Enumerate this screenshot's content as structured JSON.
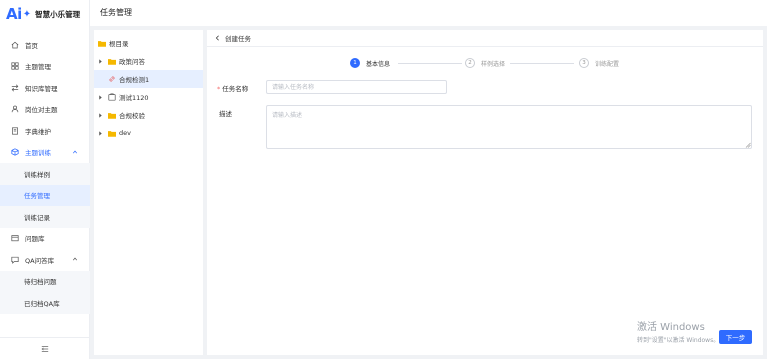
{
  "app": {
    "logo_mark": "Ai",
    "logo_star": "✦",
    "name": "智慧小乐管理"
  },
  "header": {
    "title": "任务管理"
  },
  "sidebar": {
    "items": [
      {
        "label": "首页",
        "icon": "home-icon"
      },
      {
        "label": "主题管理",
        "icon": "grid-icon"
      },
      {
        "label": "知识库管理",
        "icon": "swap-icon"
      },
      {
        "label": "岗位对主题",
        "icon": "user-icon"
      },
      {
        "label": "字典维护",
        "icon": "book-icon"
      },
      {
        "label": "主题训练",
        "icon": "cube-icon",
        "expanded": true,
        "children": [
          {
            "label": "训练样例"
          },
          {
            "label": "任务管理",
            "active": true
          },
          {
            "label": "训练记录"
          }
        ]
      },
      {
        "label": "问题库",
        "icon": "box-icon"
      },
      {
        "label": "QA问答库",
        "icon": "chat-icon",
        "expanded": true,
        "children": [
          {
            "label": "待归档问题"
          },
          {
            "label": "已归档QA库"
          }
        ]
      }
    ]
  },
  "tree": {
    "nodes": [
      {
        "label": "根目录",
        "icon": "folder-icon"
      },
      {
        "label": "政策问答",
        "icon": "folder-icon"
      },
      {
        "label": "合规检测1",
        "icon": "link-icon",
        "active": true
      },
      {
        "label": "测试1120",
        "icon": "box-icon"
      },
      {
        "label": "合规校验",
        "icon": "folder-icon"
      },
      {
        "label": "dev",
        "icon": "folder-icon"
      }
    ]
  },
  "main": {
    "back_label": "创建任务",
    "steps": [
      {
        "num": "1",
        "label": "基本信息",
        "active": true
      },
      {
        "num": "2",
        "label": "样例选择",
        "active": false
      },
      {
        "num": "3",
        "label": "训练配置",
        "active": false
      }
    ],
    "form": {
      "task_name_label": "任务名称",
      "task_name_placeholder": "请输入任务名称",
      "task_name_value": "",
      "desc_label": "描述",
      "desc_placeholder": "请输入描述",
      "desc_value": ""
    },
    "next_label": "下一步"
  },
  "watermark": {
    "line1": "激活 Windows",
    "line2": "转到\"设置\"以激活 Windows。"
  },
  "colors": {
    "accent": "#2f6bff",
    "required": "#f56c6c",
    "folder": "#f5b800",
    "active_bg": "#e6efff"
  }
}
